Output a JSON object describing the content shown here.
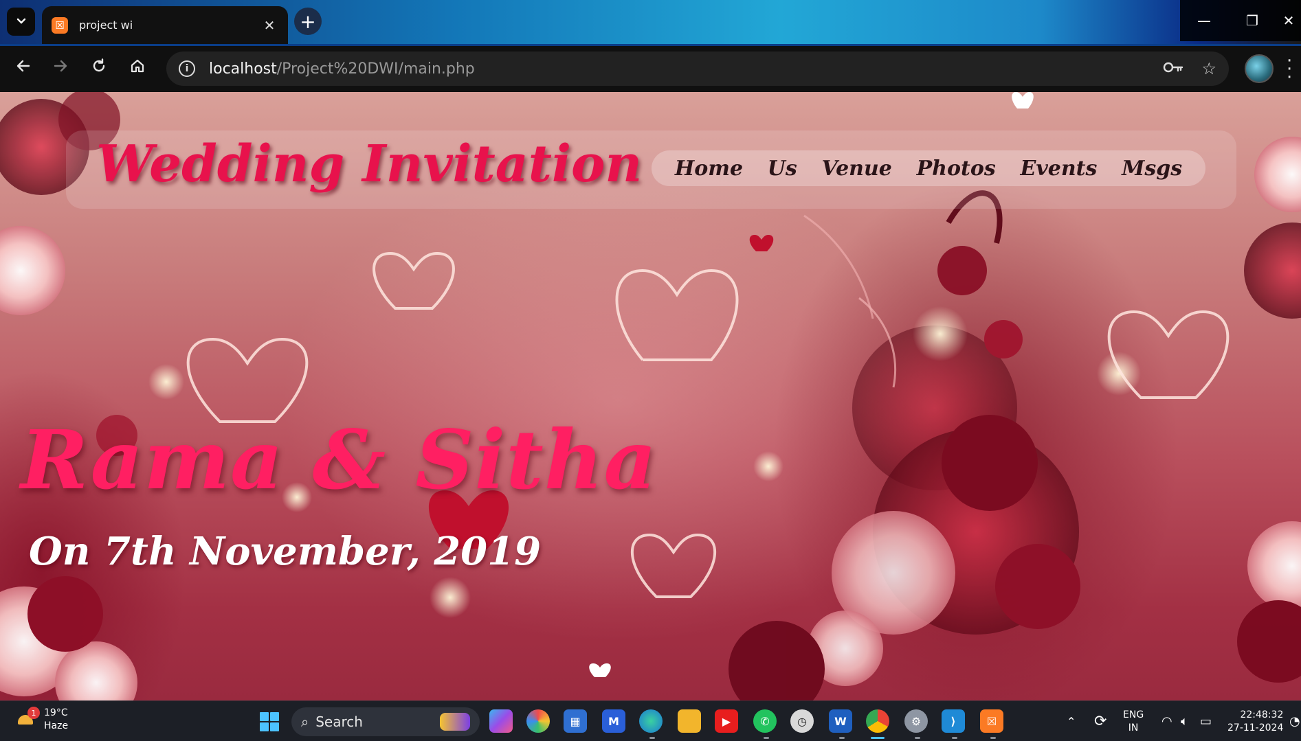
{
  "browser": {
    "tab_title": "project wi",
    "url_host": "localhost",
    "url_path": "/Project%20DWI/main.php",
    "icons": {
      "tab_dropdown": "chevron-down-icon",
      "favicon": "xampp-icon",
      "tab_close": "close-icon",
      "new_tab": "plus-icon",
      "back": "arrow-left-icon",
      "forward": "arrow-right-icon",
      "reload": "reload-icon",
      "home": "home-icon",
      "site_info": "info-icon",
      "passwords": "key-icon",
      "bookmark": "star-icon",
      "profile": "avatar",
      "menu": "more-vertical-icon",
      "minimize": "minimize-icon",
      "restore": "restore-icon",
      "close_window": "close-icon"
    }
  },
  "page": {
    "title": "Wedding Invitation",
    "nav": [
      "Home",
      "Us",
      "Venue",
      "Photos",
      "Events",
      "Msgs"
    ],
    "couple": "Rama & Sitha",
    "date_line": "On 7th November, 2019",
    "colors": {
      "title": "#e8124c",
      "couple": "#ff1f62",
      "date": "#ffffff",
      "nav_text": "#2a1418"
    }
  },
  "taskbar": {
    "weather_temp": "19°C",
    "weather_desc": "Haze",
    "weather_badge": "1",
    "search_label": "Search",
    "lang_top": "ENG",
    "lang_bottom": "IN",
    "time": "22:48:32",
    "date": "27-11-2024",
    "apps": [
      "copilot-icon",
      "photos-icon",
      "store-icon",
      "mail-icon",
      "edge-icon",
      "file-explorer-icon",
      "youtube-icon",
      "whatsapp-icon",
      "clock-icon",
      "word-icon",
      "chrome-icon",
      "settings-icon",
      "vscode-icon",
      "xampp-icon"
    ]
  }
}
